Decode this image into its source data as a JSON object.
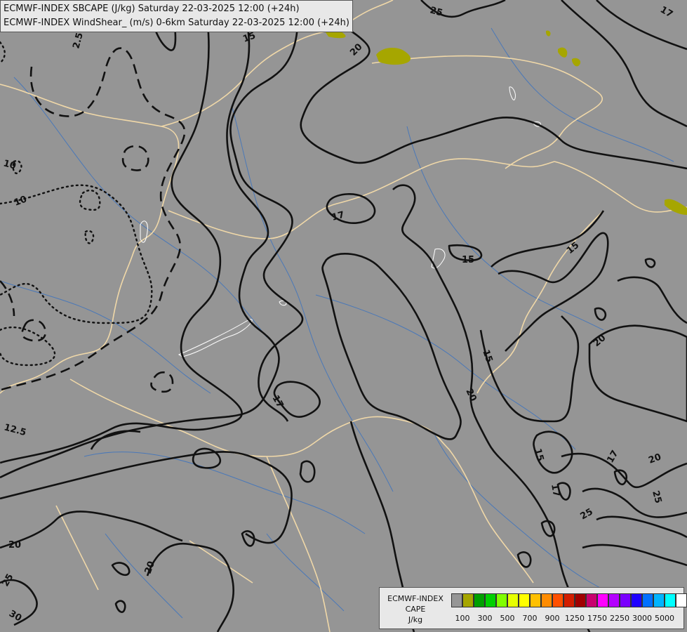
{
  "title": {
    "line1": "ECMWF-INDEX SBCAPE (J/kg) Saturday 22-03-2025 12:00 (+24h)",
    "line2": "ECMWF-INDEX WindShear_ (m/s) 0-6km Saturday 22-03-2025 12:00 (+24h)"
  },
  "contour_labels": [
    "2.5",
    "10",
    "10",
    "12.5",
    "15",
    "15",
    "15",
    "15",
    "15",
    "17",
    "17",
    "17",
    "17",
    "17",
    "20",
    "20",
    "20",
    "20",
    "20",
    "20",
    "25",
    "25",
    "25",
    "25",
    "30"
  ],
  "legend": {
    "caption_line1": "ECMWF-INDEX",
    "caption_line2": "CAPE",
    "caption_line3": "J/kg",
    "colors": [
      "#969696",
      "#a6a600",
      "#00a000",
      "#00d000",
      "#80ff00",
      "#e6ff00",
      "#ffff00",
      "#ffc000",
      "#ff8c00",
      "#ff5000",
      "#d21e00",
      "#a00000",
      "#c8006e",
      "#ff00ff",
      "#b400ff",
      "#7a00ff",
      "#1e00ff",
      "#0070ff",
      "#00b4ff",
      "#00ffff",
      "#ffffff"
    ],
    "ticks": [
      "100",
      "300",
      "500",
      "700",
      "900",
      "1250",
      "1750",
      "2250",
      "3000",
      "5000"
    ]
  },
  "colors": {
    "background": "#959595",
    "borders": "#f0d8a8",
    "rivers": "#4a78b8",
    "contours": "#111111",
    "cape_low": "#a6a600"
  }
}
